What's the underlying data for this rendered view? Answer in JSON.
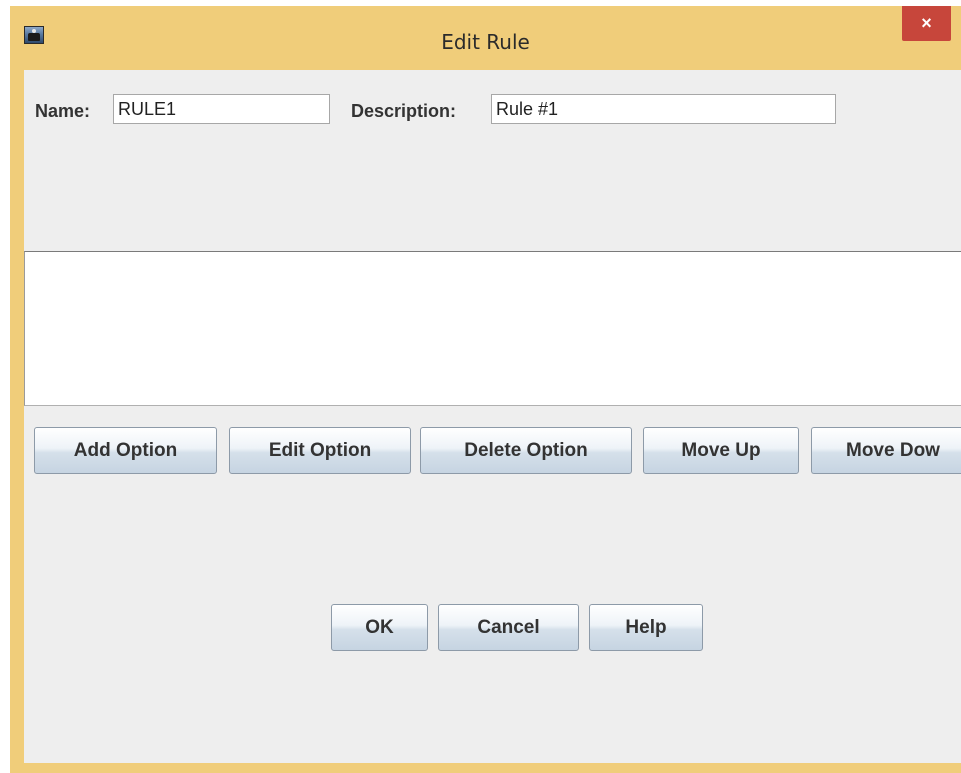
{
  "window": {
    "title": "Edit Rule",
    "close_label": "×"
  },
  "form": {
    "name_label": "Name:",
    "name_value": "RULE1",
    "description_label": "Description:",
    "description_value": "Rule #1"
  },
  "option_buttons": {
    "add": "Add Option",
    "edit": "Edit Option",
    "delete": "Delete Option",
    "move_up": "Move Up",
    "move_down": "Move Dow"
  },
  "dialog_buttons": {
    "ok": "OK",
    "cancel": "Cancel",
    "help": "Help"
  },
  "icons": {
    "app": "app-icon",
    "close": "close-icon"
  },
  "colors": {
    "title_bar": "#f0cd7a",
    "close_button": "#c7463b",
    "panel_background": "#eeeeee"
  }
}
